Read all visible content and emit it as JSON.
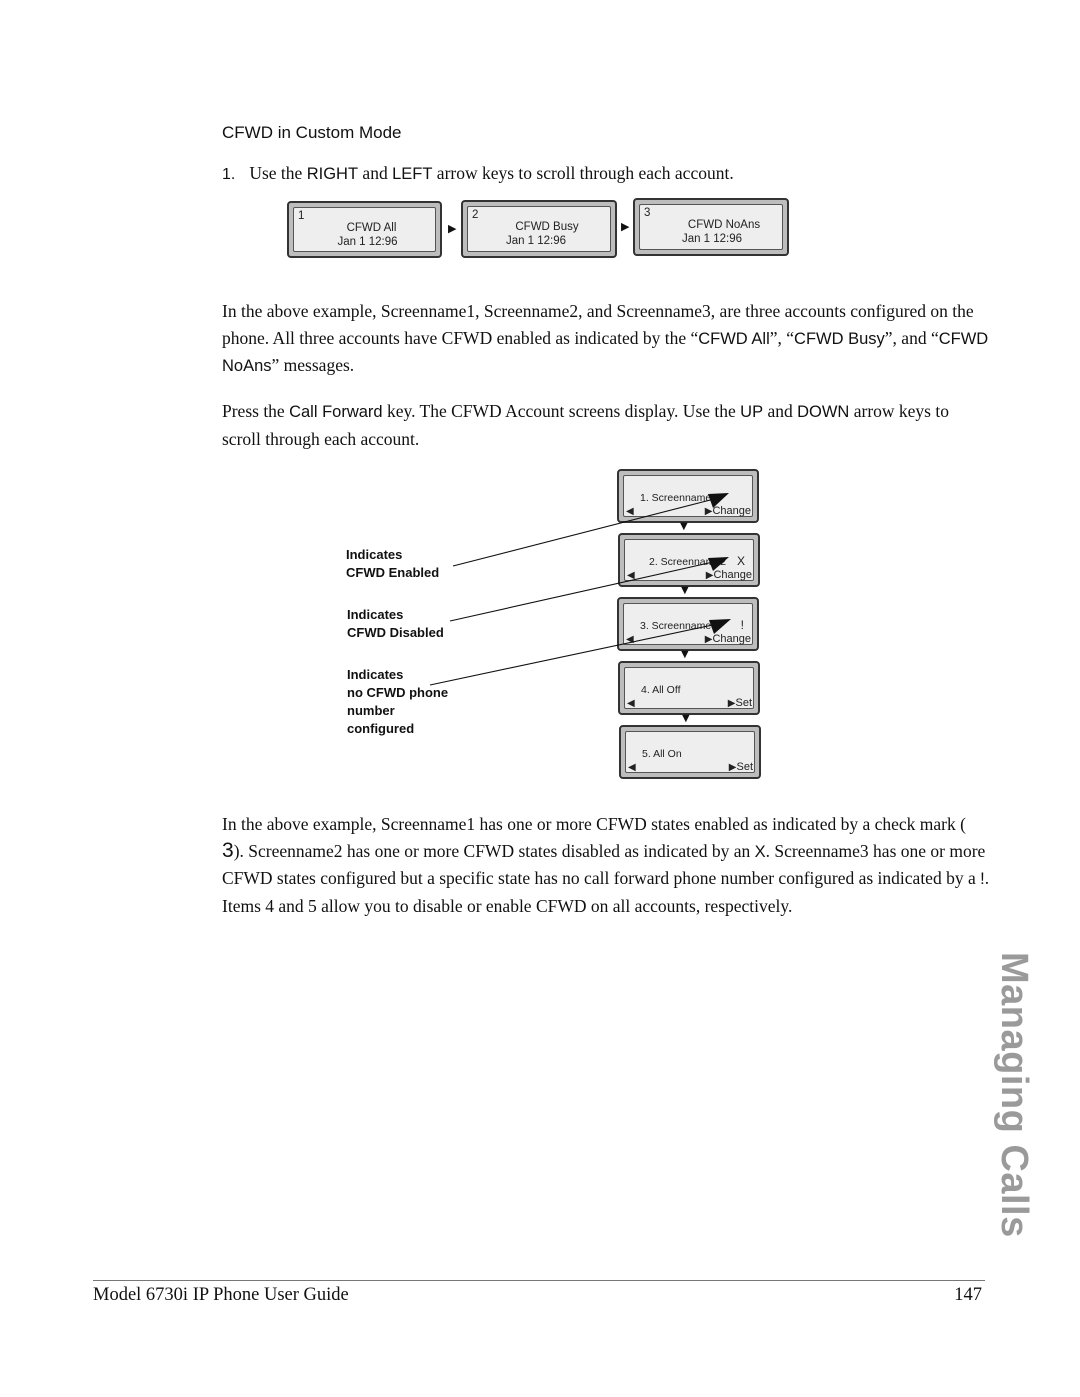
{
  "section": {
    "heading": "CFWD in Custom Mode"
  },
  "step1": {
    "number": "1.",
    "text_a": "Use the ",
    "kw_right": "RIGHT",
    "text_b": " and ",
    "kw_left": "LEFT",
    "text_c": " arrow keys to scroll through each account."
  },
  "account_screens": [
    {
      "account": "1",
      "message": "CFWD All",
      "date": "Jan 1 12:96"
    },
    {
      "account": "2",
      "message": "CFWD Busy",
      "date": "Jan 1 12:96"
    },
    {
      "account": "3",
      "message": "CFWD NoAns",
      "date": "Jan 1 12:96"
    }
  ],
  "icons": {
    "right_triangle": "▶",
    "left_triangle": "◀",
    "down_triangle": "▼"
  },
  "para1": {
    "a": "In the above example, Screenname1, Screenname2, and Screenname3, are three accounts configured on the phone. All three accounts have CFWD enabled as indicated by the “",
    "k1": "CFWD All",
    "b": "”, “",
    "k2": "CFWD Busy",
    "c": "”, and “",
    "k3": "CFWD NoAns",
    "d": "” messages."
  },
  "para2": {
    "a": "Press the ",
    "k1": "Call Forward",
    "b": " key. The CFWD Account screens display. Use the ",
    "k2": "UP",
    "c": " and ",
    "k3": "DOWN",
    "d": " arrow keys to scroll through each account."
  },
  "menu_screens": [
    {
      "label": "1.  Screenname1",
      "mark": "",
      "softkey": "Change"
    },
    {
      "label": "2.  Screenname2",
      "mark": "X",
      "softkey": "Change"
    },
    {
      "label": "3.  Screenname3",
      "mark": "!",
      "softkey": "Change"
    },
    {
      "label": "4.  All Off",
      "mark": "",
      "softkey": "Set"
    },
    {
      "label": "5.  All On",
      "mark": "",
      "softkey": "Set"
    }
  ],
  "callouts": [
    {
      "line1": "Indicates",
      "line2": "CFWD Enabled"
    },
    {
      "line1": "Indicates",
      "line2": "CFWD Disabled"
    },
    {
      "line1": "Indicates",
      "line2": "no CFWD phone",
      "line3": "number",
      "line4": "configured"
    }
  ],
  "para3": {
    "a": "In the above example, Screenname1 has one or more CFWD states enabled as indicated by a check mark ( ",
    "k1": "3",
    "b": "). Screenname2 has one or more CFWD states disabled as indicated by an ",
    "k2": "X",
    "c": ". Screenname3 has one or more CFWD states configured but a specific state has no call forward phone number configured as indicated by a ",
    "k3": "!",
    "d": ". Items 4 and 5 allow you to disable or enable CFWD on all accounts, respectively."
  },
  "side_tab": "Managing Calls",
  "footer": {
    "title": "Model 6730i IP Phone User Guide",
    "page": "147"
  }
}
